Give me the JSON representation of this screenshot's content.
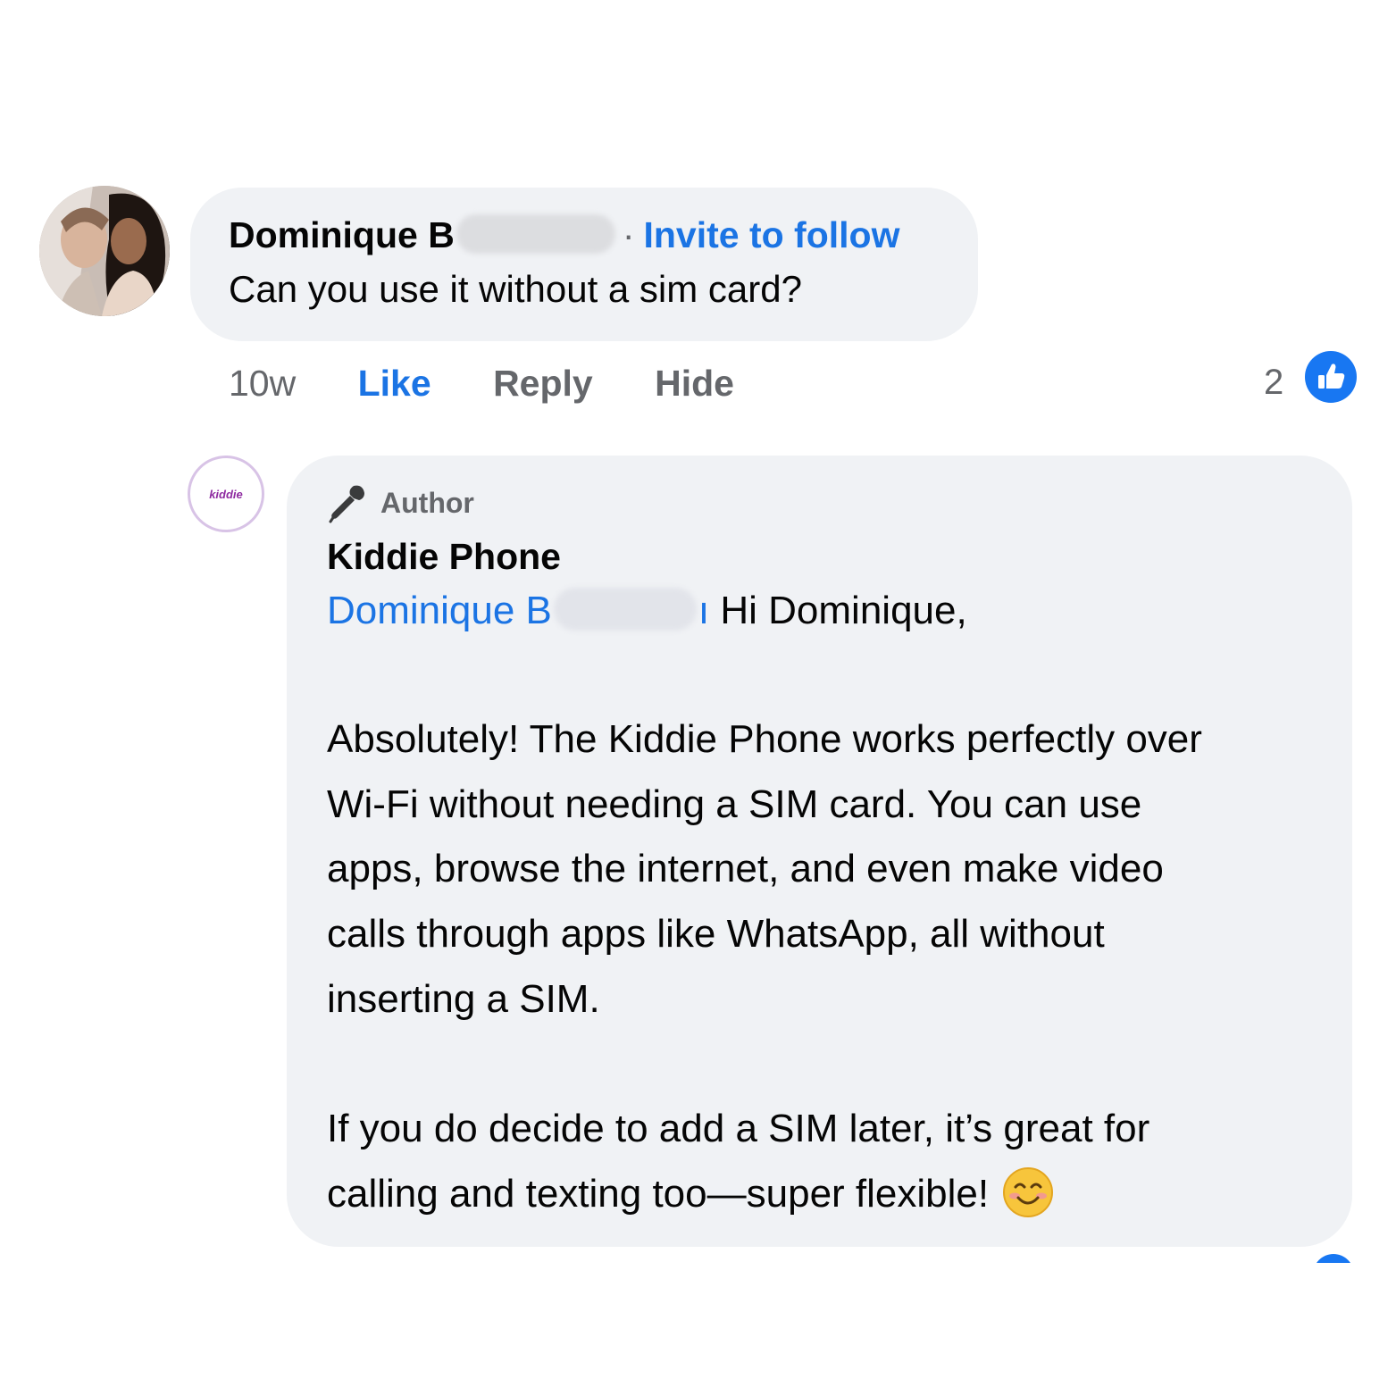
{
  "comment": {
    "author": "Dominique B",
    "separator": "·",
    "invite_label": "Invite to follow",
    "text": "Can you use it without a sim card?",
    "time": "10w",
    "actions": {
      "like": "Like",
      "reply": "Reply",
      "hide": "Hide"
    },
    "reaction_count": "2",
    "reaction_icon": "like-icon"
  },
  "reply": {
    "badge_label": "Author",
    "badge_icon": "microphone-icon",
    "author": "Kiddie Phone",
    "avatar_text": "kiddie",
    "mention": "Dominique B",
    "mention_tail": "ı",
    "greeting": "Hi Dominique,",
    "paragraph_1": "Absolutely! The Kiddie Phone works perfectly over\nWi-Fi without needing a SIM card. You can use\napps, browse the internet, and even make video\ncalls through apps like WhatsApp, all without\ninserting a SIM.",
    "paragraph_2": "If you do decide to add a SIM later, it’s great for\ncalling and texting too—super flexible!",
    "emoji": "smiling-face-icon"
  },
  "colors": {
    "link": "#1b74e4",
    "bubble": "#f0f2f5",
    "muted": "#65676b",
    "like_badge": "#1877f2"
  }
}
